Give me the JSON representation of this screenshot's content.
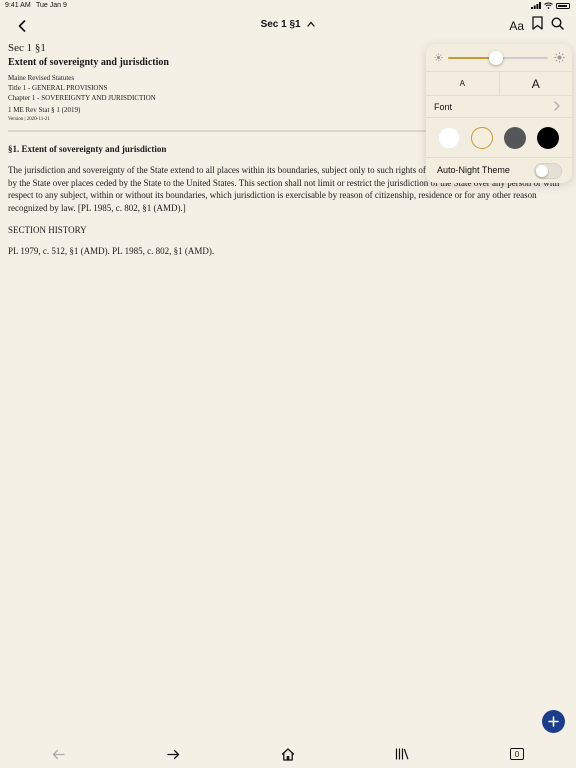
{
  "status_bar": {
    "time": "9:41 AM",
    "date": "Tue Jan 9"
  },
  "nav": {
    "title": "Sec 1 §1",
    "font_button": "Aa"
  },
  "document": {
    "sec_title": "Sec 1 §1",
    "heading": "Extent of sovereignty and jurisdiction",
    "meta_lines": [
      "Maine Revised Statutes",
      "Title 1 - GENERAL PROVISIONS",
      "Chapter 1 - SOVEREIGNTY AND JURISDICTION",
      "1 ME Rev Stat § 1 (2019)"
    ],
    "version": "Version | 2020-11-21",
    "section_heading": "§1. Extent of sovereignty and jurisdiction",
    "paragraph": "The jurisdiction and sovereignty of the State extend to all places within its boundaries, subject only to such rights of concurrent jurisdiction as are granted by the State over places ceded by the State to the United States. This section shall not limit or restrict the jurisdiction of the State over any person or with respect to any subject, within or without its boundaries, which jurisdiction is exercisable by reason of citizenship, residence or for any other reason recognized by law.   [PL 1985, c. 802, §1 (AMD).]",
    "history_heading": "SECTION HISTORY",
    "history": "PL 1979, c. 512, §1 (AMD). PL 1985, c. 802, §1 (AMD)."
  },
  "popover": {
    "brightness": 0.48,
    "font_small_label": "A",
    "font_large_label": "A",
    "font_label": "Font",
    "themes": [
      {
        "name": "white",
        "color": "#ffffff",
        "selected": false
      },
      {
        "name": "sepia",
        "color": "#f5eedd",
        "selected": true
      },
      {
        "name": "gray",
        "color": "#55565a",
        "selected": false
      },
      {
        "name": "black",
        "color": "#000000",
        "selected": false
      }
    ],
    "auto_night_label": "Auto-Night Theme",
    "auto_night_on": false,
    "accent": "#c49a3a"
  },
  "toolbar": {
    "tab_count": "0"
  },
  "colors": {
    "background": "#f5f0e6",
    "fab": "#1c3c8c"
  }
}
